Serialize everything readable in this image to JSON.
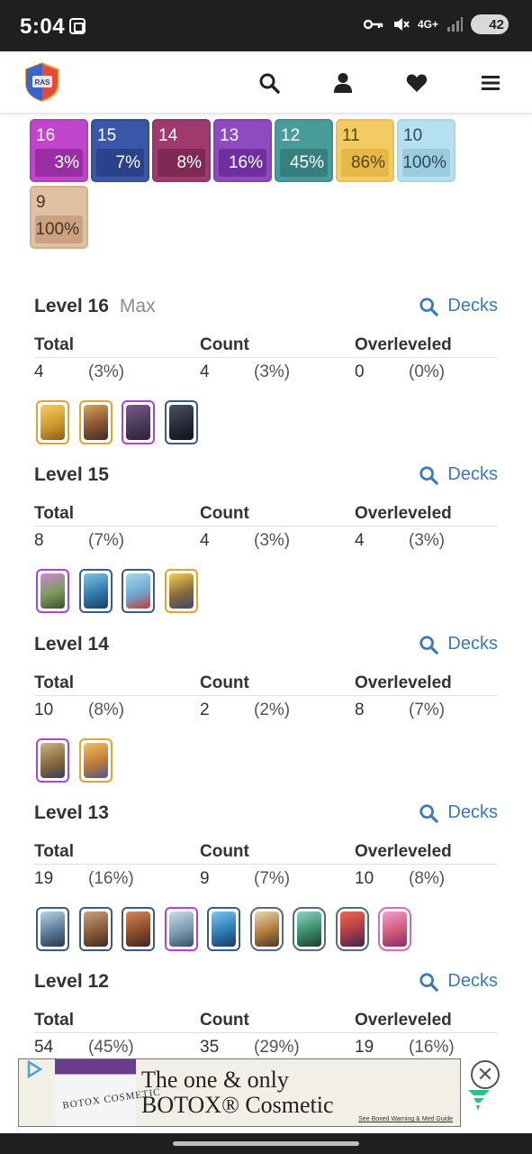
{
  "status_bar": {
    "time": "5:04",
    "network": "4G+",
    "battery": "42",
    "icons": [
      "screenshot-icon",
      "key-icon",
      "mute-icon",
      "signal-icon",
      "battery-icon"
    ]
  },
  "header": {
    "logo_text": "RAS",
    "icons": [
      "search-icon",
      "user-icon",
      "heart-icon",
      "menu-icon"
    ]
  },
  "level_pills": [
    {
      "level": "16",
      "percent": "3%",
      "bg": "#c144cc",
      "bar": "#9a2ea3",
      "border": "#b33dbd",
      "text": "#ffffff"
    },
    {
      "level": "15",
      "percent": "7%",
      "bg": "#3a56a8",
      "bar": "#2a4289",
      "border": "#334d99",
      "text": "#ffffff"
    },
    {
      "level": "14",
      "percent": "8%",
      "bg": "#a03a6e",
      "bar": "#7f2a55",
      "border": "#92336a",
      "text": "#ffffff"
    },
    {
      "level": "13",
      "percent": "16%",
      "bg": "#8e4bc0",
      "bar": "#6f2fa0",
      "border": "#8242b5",
      "text": "#ffffff"
    },
    {
      "level": "12",
      "percent": "45%",
      "bg": "#479c9a",
      "bar": "#35807e",
      "border": "#3f908e",
      "text": "#ffffff"
    },
    {
      "level": "11",
      "percent": "86%",
      "bg": "#f2cb62",
      "bar": "#e6b848",
      "border": "#e9bf52",
      "text": "#5a4500"
    },
    {
      "level": "10",
      "percent": "100%",
      "bg": "#b6e0f0",
      "bar": "#9ccbe0",
      "border": "#a7d6e9",
      "text": "#2b4a5a"
    },
    {
      "level": "9",
      "percent": "100%",
      "bg": "#e0bfa2",
      "bar": "#caa282",
      "border": "#d3b092",
      "text": "#4a3322"
    }
  ],
  "decks_label": "Decks",
  "max_label": "Max",
  "columns": {
    "total": "Total",
    "count": "Count",
    "overleveled": "Overleveled"
  },
  "sections": [
    {
      "title": "Level 16",
      "total": "4",
      "total_pct": "(3%)",
      "count": "4",
      "count_pct": "(3%)",
      "over": "0",
      "over_pct": "(0%)",
      "cards": [
        {
          "name": "golden-knight-card",
          "frame": "gold",
          "art": "linear-gradient(160deg,#f2d15a,#c8952b 60%,#8a5a18)"
        },
        {
          "name": "mighty-miner-card",
          "frame": "gold",
          "art": "linear-gradient(160deg,#d9a35a,#8a5532 55%,#3e2b22)"
        },
        {
          "name": "golem-card",
          "frame": "purple",
          "art": "linear-gradient(160deg,#7a5a8c,#4a3a5a 55%,#2e2230)"
        },
        {
          "name": "dark-prince-card",
          "frame": "blue",
          "art": "linear-gradient(160deg,#4a5266,#262b38 55%,#101319)"
        }
      ]
    },
    {
      "title": "Level 15",
      "total": "8",
      "total_pct": "(7%)",
      "count": "4",
      "count_pct": "(3%)",
      "over": "4",
      "over_pct": "(3%)",
      "cards": [
        {
          "name": "goblin-machine-card",
          "frame": "purple",
          "art": "linear-gradient(160deg,#c98ad6,#7a9a5a 55%,#3f4f2a)"
        },
        {
          "name": "freeze-card",
          "frame": "blue",
          "art": "linear-gradient(160deg,#7ec6e6,#2f7ab0 55%,#1a3f5e)"
        },
        {
          "name": "arrows-card",
          "frame": "blue",
          "art": "linear-gradient(160deg,#a9d8ee,#6fa6cc 55%,#c23b3b)"
        },
        {
          "name": "golden-knight-evo-card",
          "frame": "gold",
          "art": "linear-gradient(160deg,#f0cf55,#8a6a3a 55%,#3a4a6a)"
        }
      ]
    },
    {
      "title": "Level 14",
      "total": "10",
      "total_pct": "(8%)",
      "count": "2",
      "count_pct": "(2%)",
      "over": "8",
      "over_pct": "(7%)",
      "cards": [
        {
          "name": "prince-card",
          "frame": "purple",
          "art": "linear-gradient(160deg,#c9b58a,#8a6a3a 55%,#3a3a5a)"
        },
        {
          "name": "knight-card",
          "frame": "gold",
          "art": "linear-gradient(160deg,#f2c262,#c07a3a 55%,#4a5a8a)"
        }
      ]
    },
    {
      "title": "Level 13",
      "total": "19",
      "total_pct": "(16%)",
      "count": "9",
      "count_pct": "(7%)",
      "over": "10",
      "over_pct": "(8%)",
      "cards": [
        {
          "name": "skeletons-card",
          "frame": "blue",
          "art": "linear-gradient(160deg,#b8d6e6,#5a7a96 55%,#2a3a4a)"
        },
        {
          "name": "valkyrie-card",
          "frame": "blue",
          "art": "linear-gradient(160deg,#c9a27a,#8a5a3a 55%,#3a2a22)"
        },
        {
          "name": "hog-rider-card",
          "frame": "blue",
          "art": "linear-gradient(160deg,#d98a5a,#8a4a2a 55%,#3a2a22)"
        },
        {
          "name": "tornado-card",
          "frame": "purple",
          "art": "linear-gradient(160deg,#c8dde8,#7a98ae 55%,#3a4e5e)"
        },
        {
          "name": "electro-spirit-card",
          "frame": "blue",
          "art": "linear-gradient(160deg,#7ac8f2,#2f7ab8 55%,#1a3a66)"
        },
        {
          "name": "ram-rider-card",
          "frame": "hex",
          "art": "linear-gradient(160deg,#e8d8b0,#b07a3a 55%,#4a3a2a)"
        },
        {
          "name": "goblin-card",
          "frame": "hex",
          "art": "linear-gradient(160deg,#8ad6c8,#3a8a6a 55%,#1f3a30)"
        },
        {
          "name": "royal-giant-card",
          "frame": "hex",
          "art": "linear-gradient(160deg,#f26a4a,#a83a4a 55%,#3a2a4a)"
        },
        {
          "name": "ice-wizard-card",
          "frame": "hex",
          "art": "linear-gradient(160deg,#f2a0d0,#d05a7a 55%,#8a2a6a)"
        }
      ]
    },
    {
      "title": "Level 12",
      "total": "54",
      "total_pct": "(45%)",
      "count": "35",
      "count_pct": "(29%)",
      "over": "19",
      "over_pct": "(16%)",
      "cards": []
    }
  ],
  "ad": {
    "line1": "The one & only",
    "line2": "BOTOX® Cosmetic",
    "bottle_label": "BOTOX COSMETIC",
    "fine_print": "See Boxed Warning & Med Guide",
    "close_symbol": "✕"
  }
}
